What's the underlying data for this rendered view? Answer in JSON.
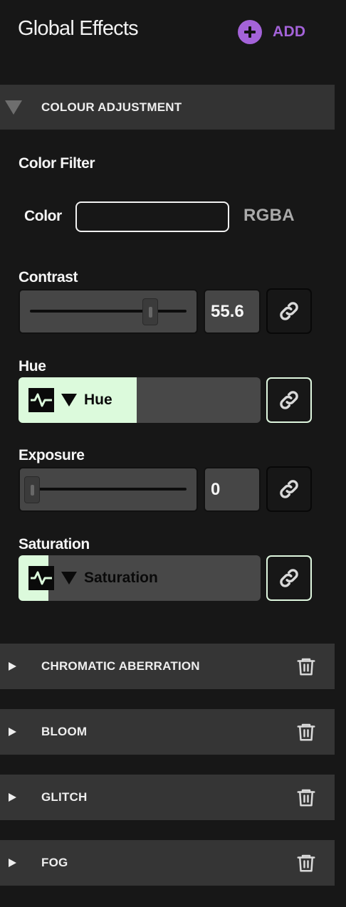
{
  "header": {
    "title": "Global Effects",
    "add_label": "ADD",
    "accent": "#a463d9"
  },
  "sections": {
    "colour_adjustment": {
      "label": "COLOUR ADJUSTMENT",
      "expanded": true,
      "color_filter": {
        "label": "Color Filter",
        "color_label": "Color",
        "color_value": "",
        "mode_label": "RGBA"
      },
      "contrast": {
        "label": "Contrast",
        "value": "55.6",
        "slider_fraction": 0.72,
        "link_icon": "link-icon"
      },
      "hue": {
        "label": "Hue",
        "modulator_label": "Hue",
        "modulation_fraction": 0.49,
        "link_icon": "link-icon"
      },
      "exposure": {
        "label": "Exposure",
        "value": "0",
        "slider_fraction": 0.0,
        "link_icon": "link-icon"
      },
      "saturation": {
        "label": "Saturation",
        "modulator_label": "Saturation",
        "modulation_fraction": 0.12,
        "link_icon": "link-icon"
      }
    },
    "collapsed": [
      {
        "label": "CHROMATIC ABERRATION",
        "icon": "trash-icon"
      },
      {
        "label": "BLOOM",
        "icon": "trash-icon"
      },
      {
        "label": "GLITCH",
        "icon": "trash-icon"
      },
      {
        "label": "FOG",
        "icon": "trash-icon"
      }
    ]
  },
  "colors": {
    "background": "#171717",
    "section_header": "#353535",
    "modulator_active": "#dcfadc",
    "control_fill": "#464646"
  }
}
